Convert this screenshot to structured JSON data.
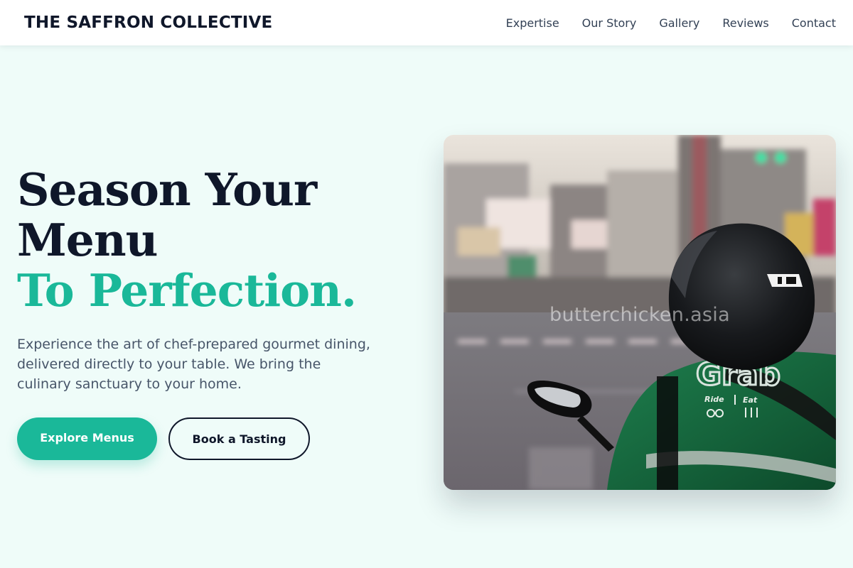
{
  "brand": {
    "name": "THE SAFFRON COLLECTIVE"
  },
  "nav": {
    "links": [
      {
        "label": "Expertise"
      },
      {
        "label": "Our Story"
      },
      {
        "label": "Gallery"
      },
      {
        "label": "Reviews"
      },
      {
        "label": "Contact"
      }
    ]
  },
  "hero": {
    "headline_line1": "Season Your",
    "headline_line2": "Menu",
    "headline_accent": "To Perfection.",
    "description": "Experience the art of chef-prepared gourmet dining, delivered directly to your table. We bring the culinary sanctuary to your home.",
    "primary_cta": "Explore Menus",
    "secondary_cta": "Book a Tasting"
  },
  "photo": {
    "watermark": "butterchicken.asia",
    "jacket_brand": "Grab",
    "jacket_ride": "Ride",
    "jacket_eat": "Eat"
  },
  "colors": {
    "accent": "#1ab899",
    "ink": "#0f172a",
    "page_background": "#effcf9"
  }
}
